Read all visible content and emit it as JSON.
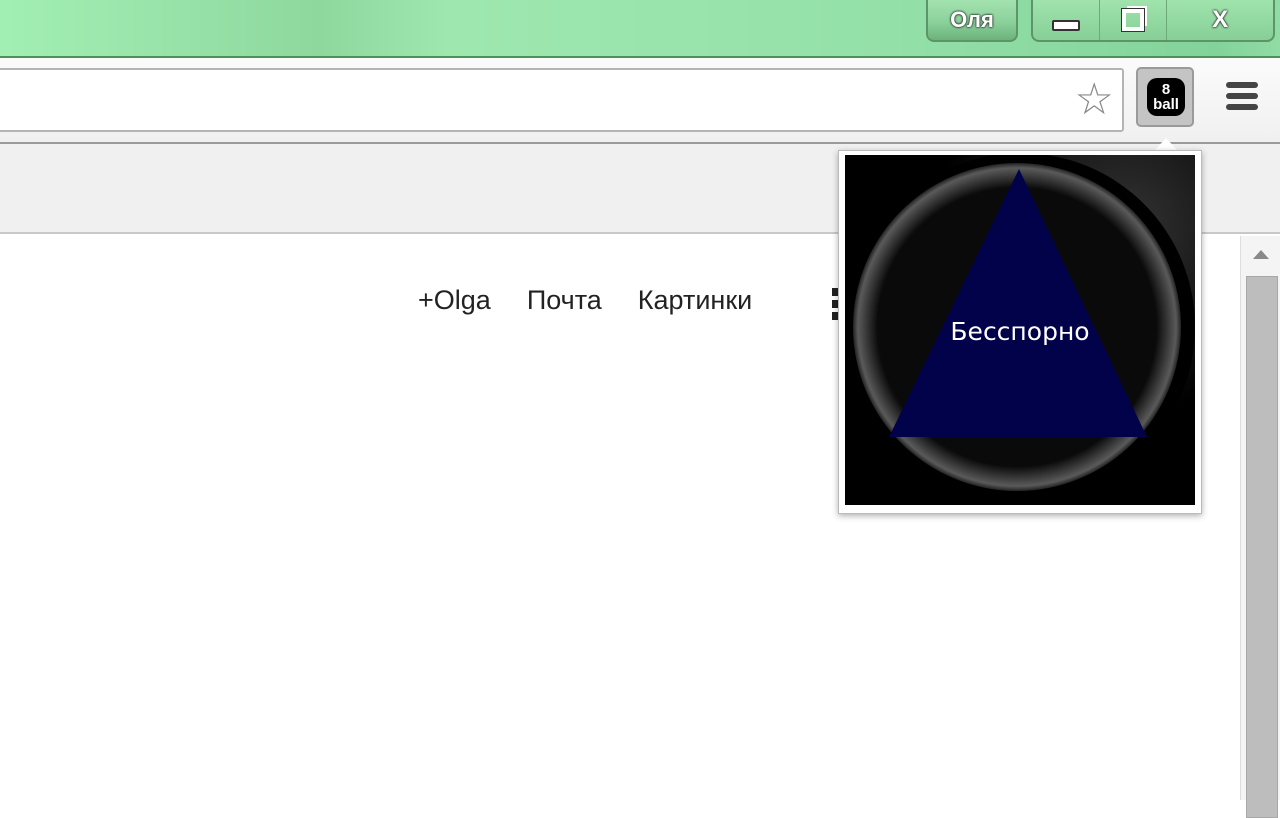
{
  "titlebar": {
    "profile_name": "Оля",
    "minimize_icon": "minimize-icon",
    "restore_icon": "restore-icon",
    "close_label": "X"
  },
  "toolbar": {
    "star_icon": "☆",
    "extension": {
      "label_top": "8",
      "label_bottom": "ball"
    }
  },
  "page": {
    "links": [
      "+Olga",
      "Почта",
      "Картинки"
    ]
  },
  "popup": {
    "answer": "Бесспорно",
    "triangle_color": "#02024a",
    "ball_color": "#0a0a0a"
  }
}
